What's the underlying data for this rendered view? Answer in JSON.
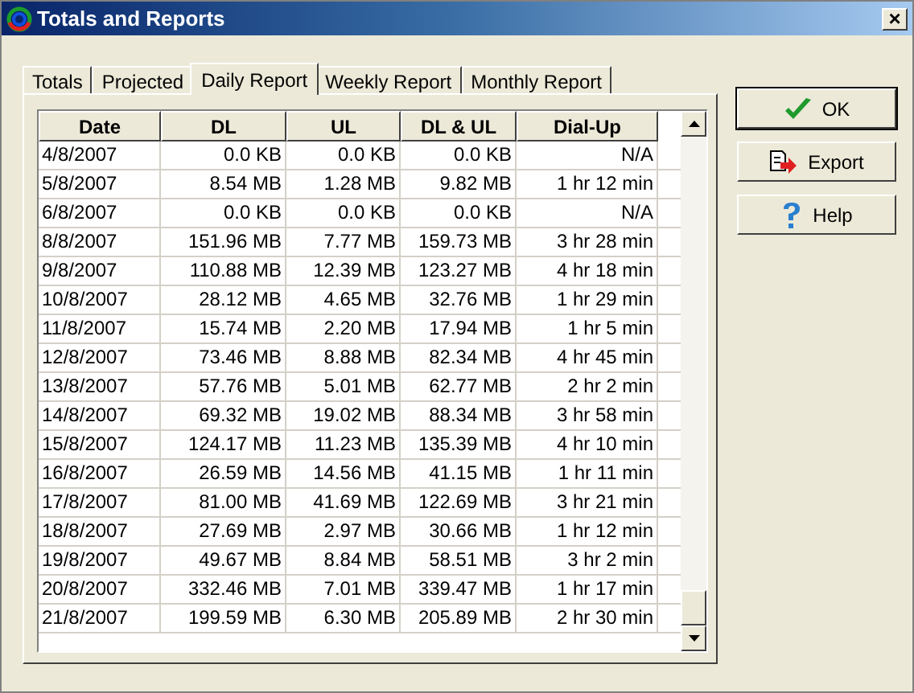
{
  "window": {
    "title": "Totals and Reports",
    "close": "×"
  },
  "tabs": [
    {
      "label": "Totals",
      "selected": false
    },
    {
      "label": "Projected",
      "selected": false
    },
    {
      "label": "Daily Report",
      "selected": true
    },
    {
      "label": "Weekly Report",
      "selected": false
    },
    {
      "label": "Monthly Report",
      "selected": false
    }
  ],
  "table": {
    "columns": [
      "Date",
      "DL",
      "UL",
      "DL & UL",
      "Dial-Up"
    ],
    "rows": [
      [
        "4/8/2007",
        "0.0 KB",
        "0.0 KB",
        "0.0 KB",
        "N/A"
      ],
      [
        "5/8/2007",
        "8.54 MB",
        "1.28 MB",
        "9.82 MB",
        "1 hr 12 min"
      ],
      [
        "6/8/2007",
        "0.0 KB",
        "0.0 KB",
        "0.0 KB",
        "N/A"
      ],
      [
        "8/8/2007",
        "151.96 MB",
        "7.77 MB",
        "159.73 MB",
        "3 hr 28 min"
      ],
      [
        "9/8/2007",
        "110.88 MB",
        "12.39 MB",
        "123.27 MB",
        "4 hr 18 min"
      ],
      [
        "10/8/2007",
        "28.12 MB",
        "4.65 MB",
        "32.76 MB",
        "1 hr 29 min"
      ],
      [
        "11/8/2007",
        "15.74 MB",
        "2.20 MB",
        "17.94 MB",
        "1 hr 5 min"
      ],
      [
        "12/8/2007",
        "73.46 MB",
        "8.88 MB",
        "82.34 MB",
        "4 hr 45 min"
      ],
      [
        "13/8/2007",
        "57.76 MB",
        "5.01 MB",
        "62.77 MB",
        "2 hr 2 min"
      ],
      [
        "14/8/2007",
        "69.32 MB",
        "19.02 MB",
        "88.34 MB",
        "3 hr 58 min"
      ],
      [
        "15/8/2007",
        "124.17 MB",
        "11.23 MB",
        "135.39 MB",
        "4 hr 10 min"
      ],
      [
        "16/8/2007",
        "26.59 MB",
        "14.56 MB",
        "41.15 MB",
        "1 hr 11 min"
      ],
      [
        "17/8/2007",
        "81.00 MB",
        "41.69 MB",
        "122.69 MB",
        "3 hr 21 min"
      ],
      [
        "18/8/2007",
        "27.69 MB",
        "2.97 MB",
        "30.66 MB",
        "1 hr 12 min"
      ],
      [
        "19/8/2007",
        "49.67 MB",
        "8.84 MB",
        "58.51 MB",
        "3 hr 2 min"
      ],
      [
        "20/8/2007",
        "332.46 MB",
        "7.01 MB",
        "339.47 MB",
        "1 hr 17 min"
      ],
      [
        "21/8/2007",
        "199.59 MB",
        "6.30 MB",
        "205.89 MB",
        "2 hr 30 min"
      ]
    ]
  },
  "buttons": [
    {
      "kind": "ok",
      "label": "OK"
    },
    {
      "kind": "export",
      "label": "Export"
    },
    {
      "kind": "help",
      "label": "Help"
    }
  ]
}
